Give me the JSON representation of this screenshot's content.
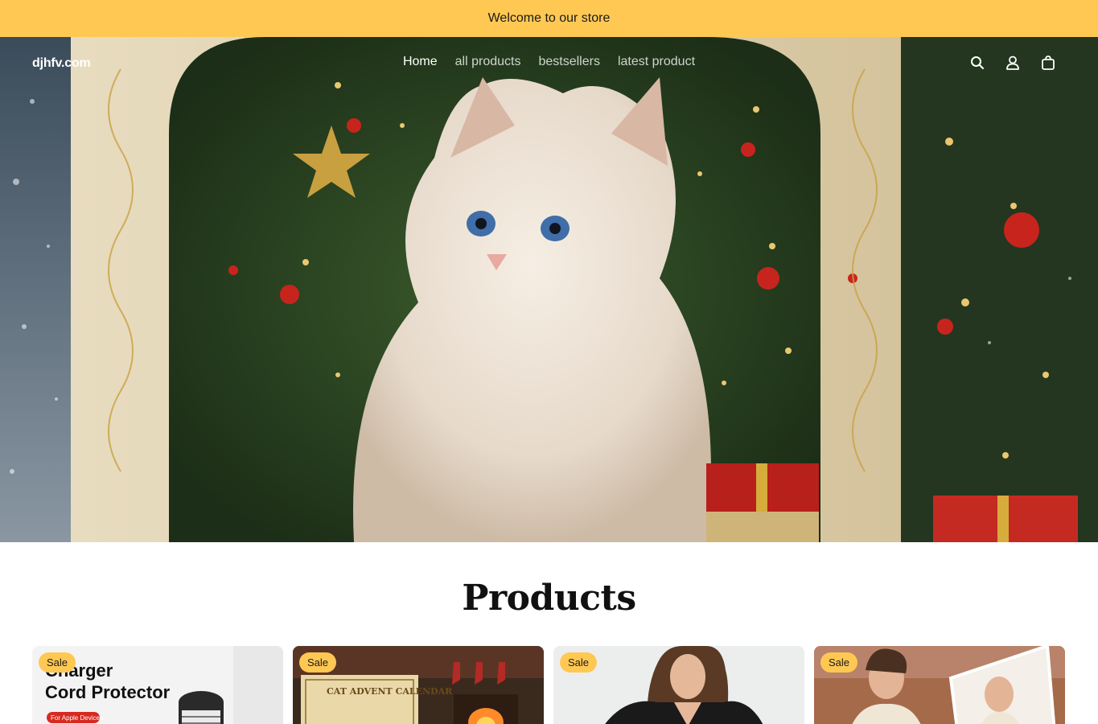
{
  "announcement": {
    "text": "Welcome to our store"
  },
  "header": {
    "logo": "djhfv.com",
    "nav": [
      {
        "label": "Home",
        "active": true
      },
      {
        "label": "all products",
        "active": false
      },
      {
        "label": "bestsellers",
        "active": false
      },
      {
        "label": "latest product",
        "active": false
      }
    ],
    "icons": [
      "search-icon",
      "account-icon",
      "cart-icon"
    ]
  },
  "products": {
    "title": "Products",
    "cards": [
      {
        "badge": "Sale",
        "image_text_line1": "Charger",
        "image_text_line2": "Cord Protector",
        "image_tag": "For Apple Devices"
      },
      {
        "badge": "Sale",
        "image_text": "CAT ADVENT CALENDAR"
      },
      {
        "badge": "Sale"
      },
      {
        "badge": "Sale"
      }
    ]
  },
  "colors": {
    "accent": "#ffc853",
    "text": "#111111",
    "background": "#ffffff"
  }
}
